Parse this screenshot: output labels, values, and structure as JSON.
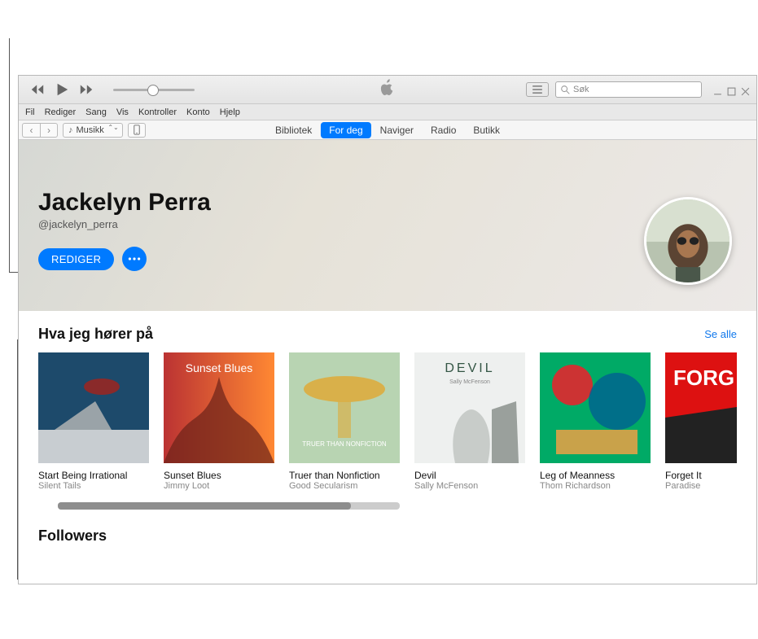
{
  "menu": [
    "Fil",
    "Rediger",
    "Sang",
    "Vis",
    "Kontroller",
    "Konto",
    "Hjelp"
  ],
  "toolbar": {
    "media_label": "Musikk",
    "tabs": [
      "Bibliotek",
      "For deg",
      "Naviger",
      "Radio",
      "Butikk"
    ],
    "active_tab": "For deg"
  },
  "search": {
    "placeholder": "Søk"
  },
  "profile": {
    "name": "Jackelyn Perra",
    "handle": "@jackelyn_perra",
    "edit": "REDIGER"
  },
  "listening": {
    "title": "Hva jeg hører på",
    "see_all": "Se alle",
    "items": [
      {
        "title": "Start Being Irrational",
        "artist": "Silent Tails"
      },
      {
        "title": "Sunset Blues",
        "artist": "Jimmy Loot"
      },
      {
        "title": "Truer than Nonfiction",
        "artist": "Good Secularism"
      },
      {
        "title": "Devil",
        "artist": "Sally McFenson"
      },
      {
        "title": "Leg of Meanness",
        "artist": "Thom Richardson"
      },
      {
        "title": "Forget It",
        "artist": "Paradise"
      }
    ]
  },
  "followers": {
    "title": "Followers"
  }
}
